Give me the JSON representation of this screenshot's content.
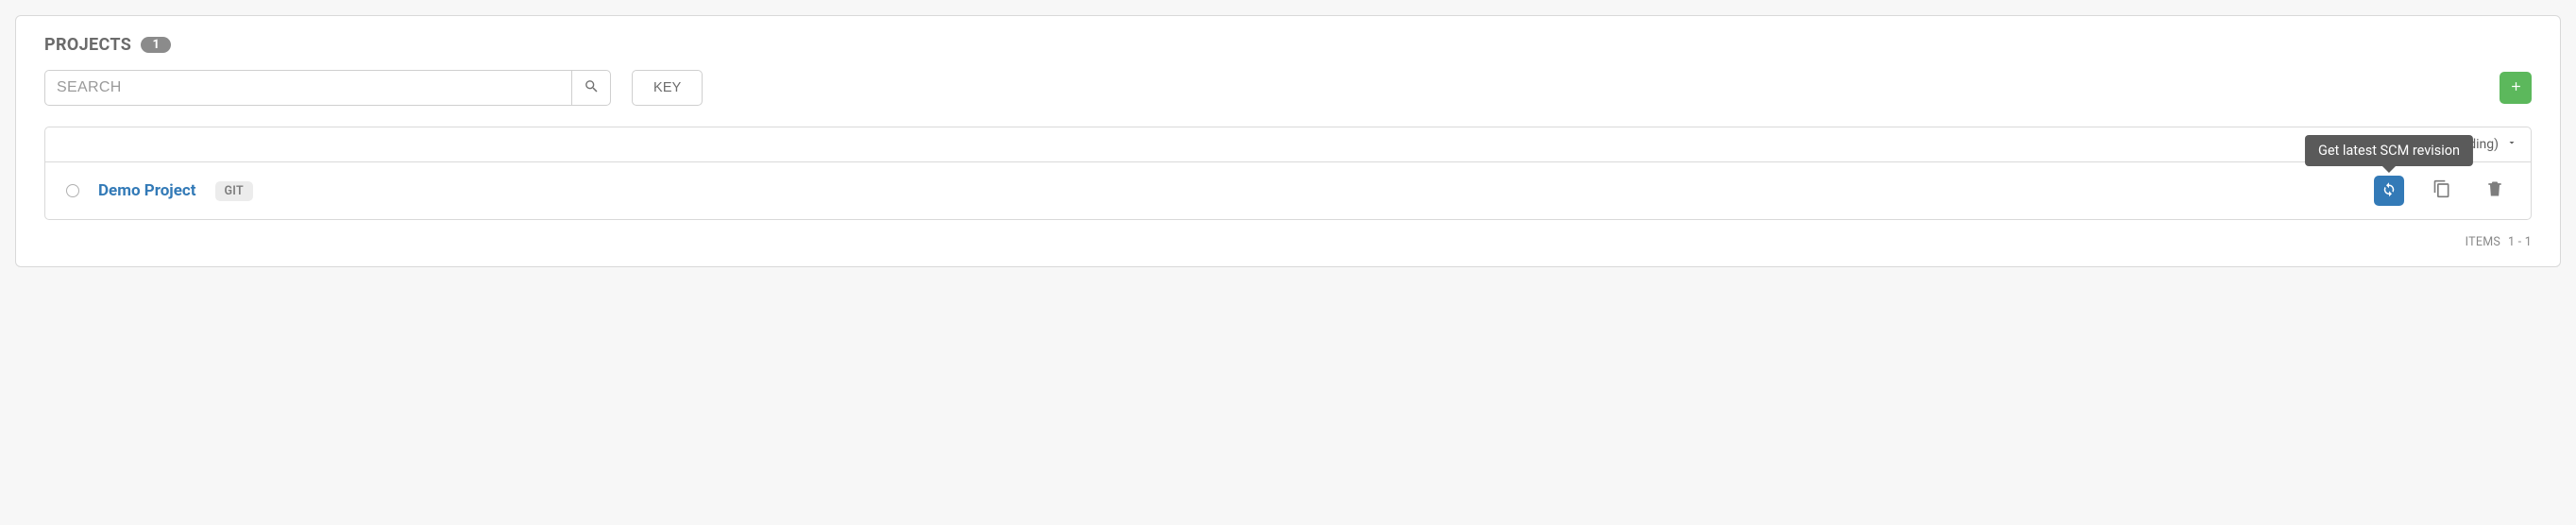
{
  "header": {
    "title": "PROJECTS",
    "count": "1"
  },
  "search": {
    "placeholder": "SEARCH",
    "value": ""
  },
  "toolbar": {
    "key_label": "KEY"
  },
  "sort": {
    "visible_text": "ending)"
  },
  "row": {
    "name": "Demo Project",
    "scm": "GIT"
  },
  "tooltip": {
    "refresh": "Get latest SCM revision"
  },
  "footer": {
    "items_label": "ITEMS",
    "range": "1 - 1"
  }
}
